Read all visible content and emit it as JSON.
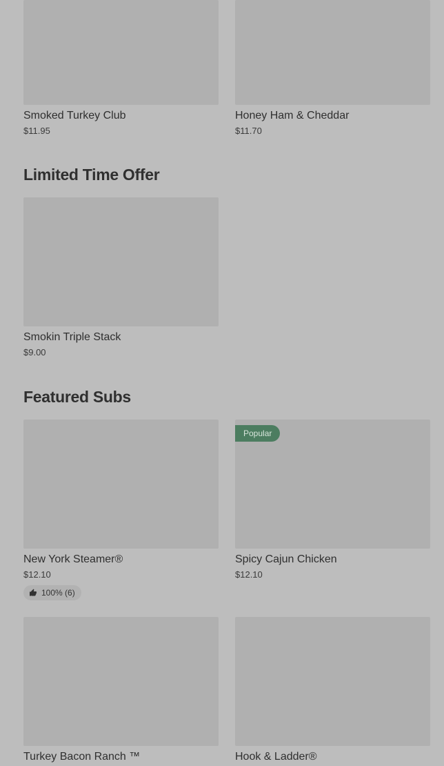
{
  "sections": {
    "limited_title": "Limited Time Offer",
    "featured_title": "Featured Subs"
  },
  "items": [
    {
      "name": "Smoked Turkey Club",
      "price": "$11.95"
    },
    {
      "name": "Honey Ham & Cheddar",
      "price": "$11.70"
    },
    {
      "name": "Smokin Triple Stack",
      "price": "$9.00"
    },
    {
      "name": "New York Steamer®",
      "price": "$12.10",
      "rating": "100% (6)"
    },
    {
      "name": "Spicy Cajun Chicken",
      "price": "$12.10",
      "badge": "Popular"
    },
    {
      "name": "Turkey Bacon Ranch ™",
      "price": ""
    },
    {
      "name": "Hook & Ladder®",
      "price": ""
    }
  ],
  "icons": {
    "rating": "thumbs-up-icon"
  },
  "colors": {
    "background": "#bdbdbd",
    "image_placeholder": "#b0b0b0",
    "badge": "#4c7d60"
  }
}
